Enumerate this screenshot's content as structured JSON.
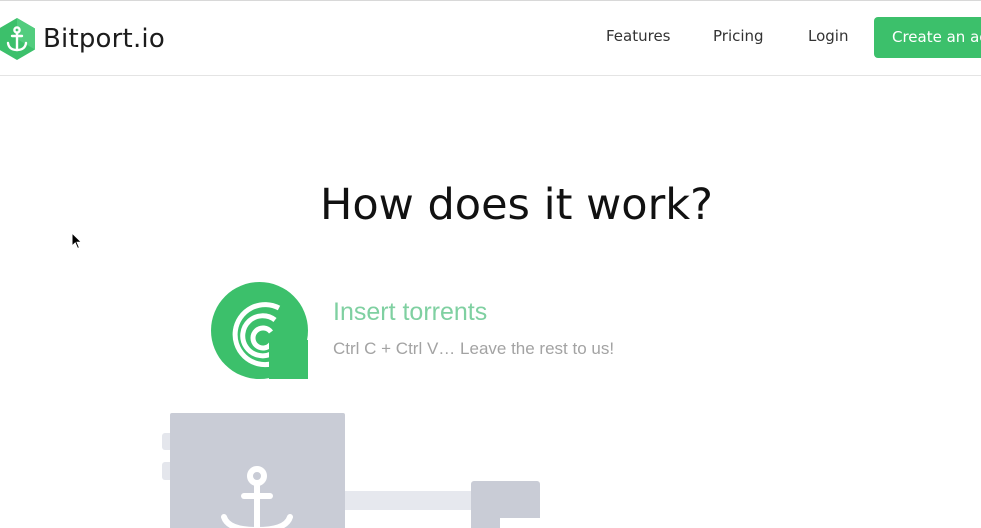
{
  "header": {
    "logo": {
      "brand": "Bitport",
      "tld": ".io"
    },
    "nav": {
      "features": "Features",
      "pricing": "Pricing",
      "login": "Login"
    },
    "cta_label": "Create an account"
  },
  "main": {
    "title": "How does it work?",
    "steps": [
      {
        "title": "Insert torrents",
        "description": "Ctrl C + Ctrl V… Leave the rest to us!"
      }
    ]
  },
  "colors": {
    "brand_green": "#3cc06b",
    "step_title": "#7fd0a1",
    "illustration_gray": "#c9ccd6"
  },
  "icons": [
    "anchor-icon",
    "torrent-icon",
    "cursor-icon"
  ]
}
